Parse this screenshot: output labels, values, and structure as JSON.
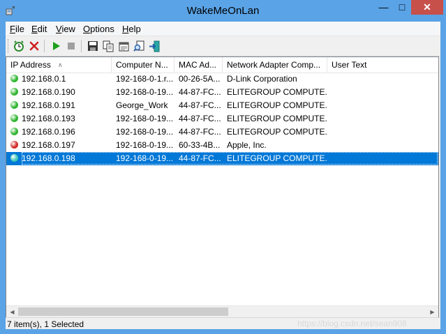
{
  "window": {
    "title": "WakeMeOnLan",
    "controls": {
      "minimize": "—",
      "maximize": "□",
      "close": "✕"
    }
  },
  "menu": [
    {
      "label": "File",
      "accel": "F",
      "rest": "ile"
    },
    {
      "label": "Edit",
      "accel": "E",
      "rest": "dit"
    },
    {
      "label": "View",
      "accel": "V",
      "rest": "iew"
    },
    {
      "label": "Options",
      "accel": "O",
      "rest": "ptions"
    },
    {
      "label": "Help",
      "accel": "H",
      "rest": "elp"
    }
  ],
  "toolbar": [
    {
      "icon": "alarm-clock-icon",
      "tooltip": "Start Scanning"
    },
    {
      "icon": "delete-x-icon",
      "tooltip": "Delete"
    },
    {
      "icon": "play-icon",
      "tooltip": "Start"
    },
    {
      "icon": "stop-icon",
      "tooltip": "Stop"
    },
    {
      "icon": "save-icon",
      "tooltip": "Save"
    },
    {
      "icon": "copy-icon",
      "tooltip": "Copy"
    },
    {
      "icon": "properties-icon",
      "tooltip": "Properties"
    },
    {
      "icon": "find-icon",
      "tooltip": "Find"
    },
    {
      "icon": "exit-icon",
      "tooltip": "Exit"
    }
  ],
  "columns": [
    {
      "label": "IP Address"
    },
    {
      "label": "Computer N..."
    },
    {
      "label": "MAC Ad..."
    },
    {
      "label": "Network Adapter Comp..."
    },
    {
      "label": "User Text"
    }
  ],
  "rows": [
    {
      "status": "online",
      "status_color": "#2fb52f",
      "ip": "192.168.0.1",
      "computer": "192-168-0-1.r...",
      "mac": "00-26-5A...",
      "adapter": "D-Link Corporation",
      "user_text": ""
    },
    {
      "status": "online",
      "status_color": "#2fb52f",
      "ip": "192.168.0.190",
      "computer": "192-168-0-19...",
      "mac": "44-87-FC...",
      "adapter": "ELITEGROUP COMPUTE...",
      "user_text": ""
    },
    {
      "status": "online",
      "status_color": "#2fb52f",
      "ip": "192.168.0.191",
      "computer": "George_Work",
      "mac": "44-87-FC...",
      "adapter": "ELITEGROUP COMPUTE...",
      "user_text": ""
    },
    {
      "status": "online",
      "status_color": "#2fb52f",
      "ip": "192.168.0.193",
      "computer": "192-168-0-19...",
      "mac": "44-87-FC...",
      "adapter": "ELITEGROUP COMPUTE...",
      "user_text": ""
    },
    {
      "status": "online",
      "status_color": "#2fb52f",
      "ip": "192.168.0.196",
      "computer": "192-168-0-19...",
      "mac": "44-87-FC...",
      "adapter": "ELITEGROUP COMPUTE...",
      "user_text": ""
    },
    {
      "status": "offline",
      "status_color": "#d42828",
      "ip": "192.168.0.197",
      "computer": "192-168-0-19...",
      "mac": "60-33-4B...",
      "adapter": "Apple, Inc.",
      "user_text": ""
    },
    {
      "status": "selected",
      "status_color": "#3fc7b8",
      "ip": "192.168.0.198",
      "computer": "192-168-0-19...",
      "mac": "44-87-FC...",
      "adapter": "ELITEGROUP COMPUTE...",
      "user_text": "",
      "selected": true
    }
  ],
  "statusbar": {
    "text": "7 item(s), 1 Selected",
    "watermark": "https://blog.csdn.net/sean908"
  },
  "colors": {
    "titlebar": "#5aa3e6",
    "selection": "#0078d7",
    "close_button": "#c7504b"
  }
}
